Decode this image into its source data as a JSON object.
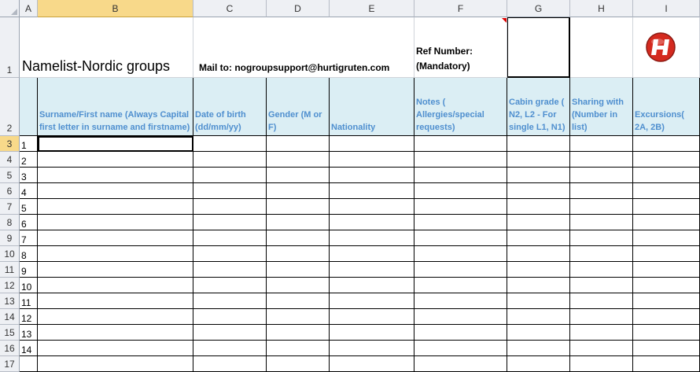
{
  "columns": [
    "A",
    "B",
    "C",
    "D",
    "E",
    "F",
    "G",
    "H",
    "I"
  ],
  "rows": [
    "1",
    "2",
    "3",
    "4",
    "5",
    "6",
    "7",
    "8",
    "9",
    "10",
    "11",
    "12",
    "13",
    "14",
    "15",
    "16",
    "17"
  ],
  "title": "Namelist-Nordic groups",
  "mail": "Mail to: nogroupsupport@hurtigruten.com",
  "ref": {
    "line1": "Ref Number:",
    "line2": "(Mandatory)"
  },
  "headers": {
    "b": "Surname/First name (Always Capital first letter in surname and firstname)",
    "c": "Date of birth (dd/mm/yy)",
    "d": "Gender (M or F)",
    "e": "Nationality",
    "f": "Notes ( Allergies/special requests)",
    "g": "Cabin grade ( N2, L2 - For single L1, N1)",
    "h": "Sharing with (Number in list)",
    "i": "Excursions( 2A, 2B)"
  },
  "numbers": [
    "1",
    "2",
    "3",
    "4",
    "5",
    "6",
    "7",
    "8",
    "9",
    "10",
    "11",
    "12",
    "13",
    "14"
  ],
  "icons": {
    "logo": "hurtigruten-logo-icon",
    "accent": "#d42a1f"
  }
}
